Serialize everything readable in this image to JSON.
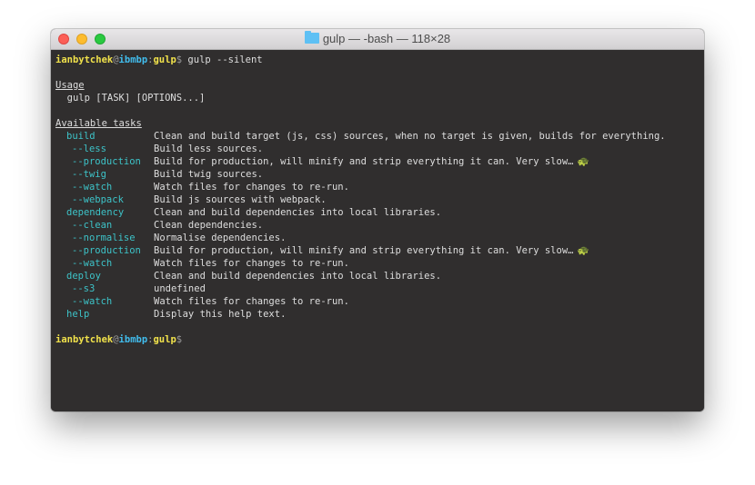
{
  "window": {
    "title": "gulp — -bash — 118×28",
    "folder_icon": "folder-icon"
  },
  "prompt": {
    "user": "ianbytchek",
    "at": "@",
    "host": "ibmbp",
    "sep": ":",
    "dir": "gulp",
    "dollar": "$",
    "command": " gulp --silent"
  },
  "usage": {
    "heading": "Usage",
    "text": "  gulp [TASK] [OPTIONS...]"
  },
  "tasks_heading": "Available tasks",
  "tasks": [
    {
      "name": "build",
      "level": "top",
      "desc": "Clean and build target (js, css) sources, when no target is given, builds for everything.",
      "snail": false
    },
    {
      "name": "--less",
      "level": "sub",
      "desc": "Build less sources.",
      "snail": false
    },
    {
      "name": "--production",
      "level": "sub",
      "desc": "Build for production, will minify and strip everything it can. Very slow…",
      "snail": true
    },
    {
      "name": "--twig",
      "level": "sub",
      "desc": "Build twig sources.",
      "snail": false
    },
    {
      "name": "--watch",
      "level": "sub",
      "desc": "Watch files for changes to re-run.",
      "snail": false
    },
    {
      "name": "--webpack",
      "level": "sub",
      "desc": "Build js sources with webpack.",
      "snail": false
    },
    {
      "name": "dependency",
      "level": "top",
      "desc": "Clean and build dependencies into local libraries.",
      "snail": false
    },
    {
      "name": "--clean",
      "level": "sub",
      "desc": "Clean dependencies.",
      "snail": false
    },
    {
      "name": "--normalise",
      "level": "sub",
      "desc": "Normalise dependencies.",
      "snail": false
    },
    {
      "name": "--production",
      "level": "sub",
      "desc": "Build for production, will minify and strip everything it can. Very slow…",
      "snail": true
    },
    {
      "name": "--watch",
      "level": "sub",
      "desc": "Watch files for changes to re-run.",
      "snail": false
    },
    {
      "name": "deploy",
      "level": "top",
      "desc": "Clean and build dependencies into local libraries.",
      "snail": false
    },
    {
      "name": "--s3",
      "level": "sub",
      "desc": "undefined",
      "snail": false
    },
    {
      "name": "--watch",
      "level": "sub",
      "desc": "Watch files for changes to re-run.",
      "snail": false
    },
    {
      "name": "help",
      "level": "top",
      "desc": "Display this help text.",
      "snail": false
    }
  ],
  "snail_glyph": "🐢",
  "colors": {
    "background": "#302e2e",
    "user": "#f1e24b",
    "host": "#41bcec",
    "task": "#3dc3c8",
    "text": "#dedede"
  }
}
